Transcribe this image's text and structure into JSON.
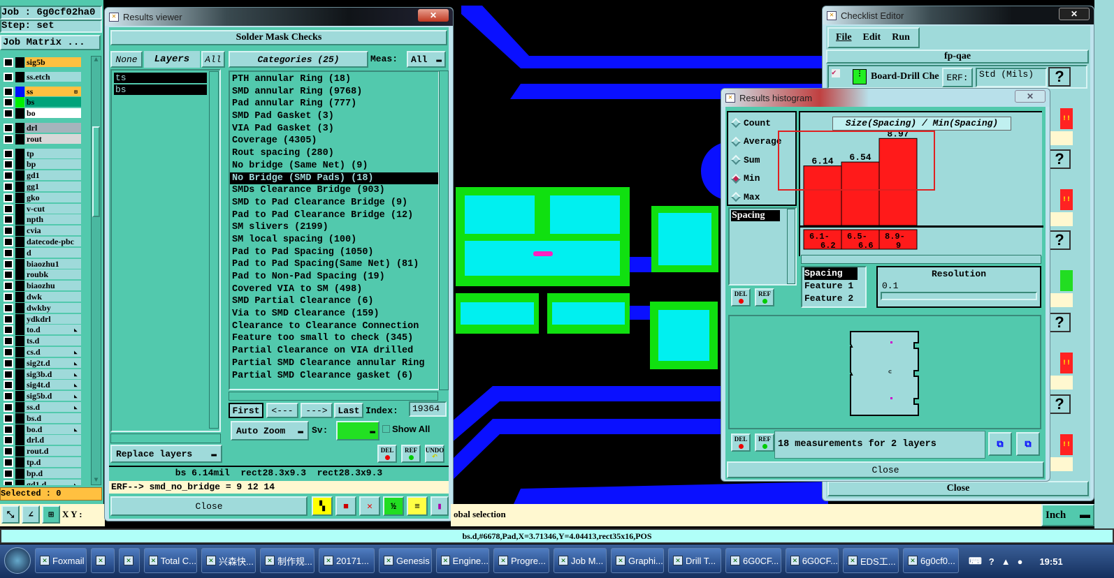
{
  "left_panel": {
    "job": "Job : 6g0cf02ha0",
    "step": "Step: set",
    "job_matrix": "Job Matrix ...",
    "selected": "Selected : 0",
    "layers": [
      {
        "name": "sig5b",
        "bg": "#ffc040",
        "sw": "#000"
      },
      {
        "name": "ss.etch",
        "bg": "#9fdada",
        "sw": "#000",
        "gap": 1
      },
      {
        "name": "ss",
        "bg": "#ffc040",
        "sw": "#0010ff",
        "gap": 1,
        "mark": "⊞"
      },
      {
        "name": "bs",
        "bg": "#00a37a",
        "sw": "#00f000"
      },
      {
        "name": "bo",
        "bg": "#ffffff",
        "sw": "#000"
      },
      {
        "name": "drl",
        "bg": "#a6b4bc",
        "sw": "#000",
        "gap": 1
      },
      {
        "name": "rout",
        "bg": "#d8d8d8",
        "sw": "#000"
      },
      {
        "name": "tp",
        "bg": "#9fdada",
        "sw": "#000",
        "gap": 1
      },
      {
        "name": "bp"
      },
      {
        "name": "gd1"
      },
      {
        "name": "gg1"
      },
      {
        "name": "gko"
      },
      {
        "name": "v-cut"
      },
      {
        "name": "npth"
      },
      {
        "name": "cvia"
      },
      {
        "name": "datecode-pbc"
      },
      {
        "name": "d"
      },
      {
        "name": "biaozhu1"
      },
      {
        "name": "roubk"
      },
      {
        "name": "biaozhu"
      },
      {
        "name": "dwk"
      },
      {
        "name": "dwkby"
      },
      {
        "name": "ydkdrl"
      },
      {
        "name": "to.d",
        "mark": "◣"
      },
      {
        "name": "ts.d"
      },
      {
        "name": "cs.d",
        "mark": "◣"
      },
      {
        "name": "sig2t.d",
        "mark": "◣"
      },
      {
        "name": "sig3b.d",
        "mark": "◣"
      },
      {
        "name": "sig4t.d",
        "mark": "◣"
      },
      {
        "name": "sig5b.d",
        "mark": "◣"
      },
      {
        "name": "ss.d",
        "mark": "◣"
      },
      {
        "name": "bs.d"
      },
      {
        "name": "bo.d",
        "mark": "◣"
      },
      {
        "name": "drl.d"
      },
      {
        "name": "rout.d"
      },
      {
        "name": "tp.d"
      },
      {
        "name": "bp.d"
      },
      {
        "name": "gd1.d",
        "mark": "◣"
      }
    ],
    "xy_label": "X Y :"
  },
  "results_viewer": {
    "title": "Results viewer",
    "header": "Solder Mask Checks",
    "none": "None",
    "layers_label": "Layers",
    "all": "All",
    "layer_list": [
      "ts",
      "bs"
    ],
    "categories_label": "Categories (25)",
    "meas_label": "Meas:",
    "meas_value": "All",
    "categories": [
      "PTH annular Ring (18)",
      "SMD annular Ring (9768)",
      "Pad annular Ring (777)",
      "SMD Pad Gasket (3)",
      "VIA Pad Gasket (3)",
      "Coverage (4305)",
      "Rout spacing (280)",
      "No bridge (Same Net) (9)",
      "No Bridge (SMD Pads) (18)",
      "SMDs Clearance Bridge (903)",
      "SMD to Pad Clearance Bridge (9)",
      "Pad to Pad Clearance Bridge (12)",
      "SM slivers (2199)",
      "SM local spacing (100)",
      "Pad to Pad Spacing (1050)",
      "Pad to Pad Spacing(Same Net) (81)",
      "Pad to Non-Pad Spacing (19)",
      "Covered VIA to SM (498)",
      "SMD Partial Clearance (6)",
      "Via to SMD Clearance (159)",
      "Clearance to Clearance Connection",
      "Feature too small to check (345)",
      "Partial Clearance on VIA drilled",
      "Partial SMD Clearance annular Ring",
      "Partial SMD Clearance gasket (6)"
    ],
    "selected_category": 8,
    "first": "First",
    "prev": "<---",
    "next": "--->",
    "last": "Last",
    "index_label": "Index:",
    "index_value": "19364",
    "auto_zoom": "Auto Zoom",
    "sv_label": "Sv:",
    "sv_color": "#22e022",
    "show_all": "Show All",
    "replace_layers": "Replace layers",
    "del": "DEL",
    "ref": "REF",
    "undo": "UNDO",
    "info": "bs 6.14mil  rect28.3x9.3  rect28.3x9.3",
    "erf": "ERF--> smd_no_bridge = 9 12 14",
    "close": "Close"
  },
  "checklist": {
    "title": "Checklist Editor",
    "menu": [
      "File",
      "Edit",
      "Run"
    ],
    "name": "fp-qae",
    "item": "Board-Drill Che",
    "erf": "ERF:",
    "std": "Std (Mils)",
    "help": "?",
    "bang": "!!",
    "close": "Close"
  },
  "histogram": {
    "title": "Results histogram",
    "modes": [
      "Count",
      "Average",
      "Sum",
      "Min",
      "Max"
    ],
    "selected_mode": "Min",
    "list": [
      "Spacing"
    ],
    "chart_title": "Size(Spacing) / Min(Spacing)",
    "chart_data": {
      "type": "bar",
      "categories": [
        "6.1-\n6.2",
        "6.5-\n6.6",
        "8.9-\n9"
      ],
      "values": [
        6.14,
        6.54,
        8.97
      ],
      "bar_color": "#ff1a1a"
    },
    "cat_labels": [
      [
        "6.1-",
        "6.2"
      ],
      [
        "6.5-",
        "6.6"
      ],
      [
        "8.9-",
        "9"
      ]
    ],
    "value_labels": [
      "6.14",
      "6.54",
      "8.97"
    ],
    "fields": [
      "Spacing",
      "Feature 1",
      "Feature 2"
    ],
    "resolution_label": "Resolution",
    "resolution_value": "0.1",
    "del": "DEL",
    "ref": "REF",
    "summary": "18 measurements for 2 layers",
    "close": "Close"
  },
  "message": "obal selection",
  "units": "Inch",
  "status": "bs.d,#6678,Pad,X=3.71346,Y=4.04413,rect35x16,POS",
  "taskbar": {
    "items": [
      {
        "label": "Foxmail",
        "w": 74
      },
      {
        "label": "",
        "w": 34
      },
      {
        "label": "",
        "w": 30
      },
      {
        "label": "Total C...",
        "w": 76
      },
      {
        "label": "兴森快...",
        "w": 78
      },
      {
        "label": "制作规...",
        "w": 78
      },
      {
        "label": "20171...",
        "w": 80
      },
      {
        "label": "Genesis",
        "w": 76
      },
      {
        "label": "Engine...",
        "w": 76
      },
      {
        "label": "Progre...",
        "w": 80
      },
      {
        "label": "Job M...",
        "w": 76
      },
      {
        "label": "Graphi...",
        "w": 76
      },
      {
        "label": "Drill T...",
        "w": 76
      },
      {
        "label": "6G0CF...",
        "w": 80
      },
      {
        "label": "6G0CF...",
        "w": 76
      },
      {
        "label": "EDS工...",
        "w": 80
      },
      {
        "label": "6g0cf0...",
        "w": 80
      }
    ],
    "clock": "19:51"
  }
}
